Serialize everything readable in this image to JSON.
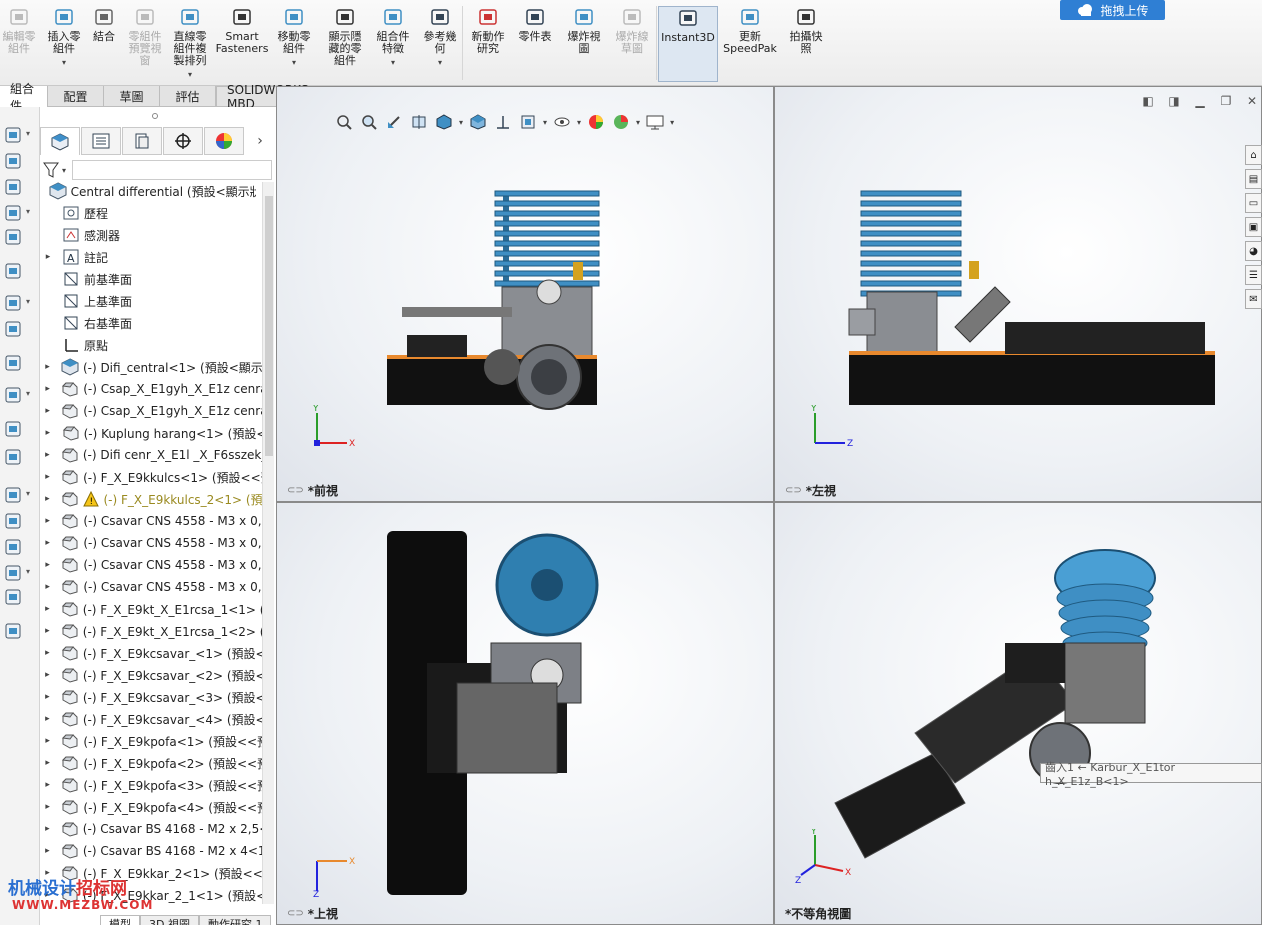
{
  "ribbon": {
    "buttons": [
      {
        "label": "編輯零\n組件",
        "icon": "edit-component-icon",
        "disabled": true
      },
      {
        "label": "插入零\n組件",
        "icon": "insert-component-icon",
        "disabled": false,
        "caret": true
      },
      {
        "label": "結合",
        "icon": "mate-icon",
        "disabled": false
      },
      {
        "label": "零組件\n預覽視\n窗",
        "icon": "component-preview-icon",
        "disabled": true
      },
      {
        "label": "直線零\n組件複\n製排列",
        "icon": "linear-pattern-icon",
        "disabled": false,
        "caret": true
      },
      {
        "label": "Smart\nFasteners",
        "icon": "smart-fasteners-icon",
        "disabled": false
      },
      {
        "label": "移動零\n組件",
        "icon": "move-component-icon",
        "disabled": false,
        "caret": true
      },
      {
        "label": "顯示隱\n藏的零\n組件",
        "icon": "show-hidden-icon",
        "disabled": false
      },
      {
        "label": "組合件\n特徵",
        "icon": "assembly-features-icon",
        "disabled": false,
        "caret": true
      },
      {
        "label": "參考幾\n何",
        "icon": "reference-geometry-icon",
        "disabled": false,
        "caret": true
      },
      {
        "label": "新動作\n研究",
        "icon": "motion-study-icon",
        "disabled": false
      },
      {
        "label": "零件表",
        "icon": "bom-icon",
        "disabled": false
      },
      {
        "label": "爆炸視\n圖",
        "icon": "exploded-view-icon",
        "disabled": false
      },
      {
        "label": "爆炸線\n草圖",
        "icon": "explode-line-sketch-icon",
        "disabled": true
      },
      {
        "label": "Instant3D",
        "icon": "instant3d-icon",
        "disabled": false,
        "active": true
      },
      {
        "label": "更新\nSpeedPak",
        "icon": "speedpak-icon",
        "disabled": false
      },
      {
        "label": "拍攝快\n照",
        "icon": "snapshot-icon",
        "disabled": false
      }
    ],
    "upload_label": "拖拽上传"
  },
  "command_tabs": [
    "組合件",
    "配置",
    "草圖",
    "評估"
  ],
  "mbd_tab": "SOLIDWORKS MBD",
  "tree": {
    "root": "Central differential  (預設<顯示狀態",
    "items": [
      {
        "label": "歷程",
        "icon": "history-icon",
        "expand": false
      },
      {
        "label": "感測器",
        "icon": "sensor-icon",
        "expand": false
      },
      {
        "label": "註記",
        "icon": "annotation-icon",
        "expand": true
      },
      {
        "label": "前基準面",
        "icon": "plane-icon",
        "expand": false
      },
      {
        "label": "上基準面",
        "icon": "plane-icon",
        "expand": false
      },
      {
        "label": "右基準面",
        "icon": "plane-icon",
        "expand": false
      },
      {
        "label": "原點",
        "icon": "origin-icon",
        "expand": false
      },
      {
        "label": "(-) Difi_central<1> (預設<顯示狀",
        "icon": "subassembly-icon",
        "expand": true
      },
      {
        "label": "(-) Csap_X_E1gyh_X_E1z cenral",
        "icon": "part-icon",
        "expand": true
      },
      {
        "label": "(-) Csap_X_E1gyh_X_E1z cenral",
        "icon": "part-icon",
        "expand": true
      },
      {
        "label": "(-) Kuplung harang<1> (預設<",
        "icon": "part-icon",
        "expand": true
      },
      {
        "label": "(-) Difi cenr_X_E1l _X_F6sszek_X",
        "icon": "part-icon",
        "expand": true
      },
      {
        "label": "(-) F_X_E9kkulcs<1> (預設<<預",
        "icon": "part-icon",
        "expand": true
      },
      {
        "label": "(-) F_X_E9kkulcs_2<1> (預設",
        "icon": "part-icon",
        "expand": true,
        "warn": true
      },
      {
        "label": "(-) Csavar CNS 4558 - M3 x 0,5",
        "icon": "part-icon",
        "expand": true
      },
      {
        "label": "(-) Csavar CNS 4558 - M3 x 0,5",
        "icon": "part-icon",
        "expand": true
      },
      {
        "label": "(-) Csavar CNS 4558 - M3 x 0,5",
        "icon": "part-icon",
        "expand": true
      },
      {
        "label": "(-) Csavar CNS 4558 - M3 x 0,5",
        "icon": "part-icon",
        "expand": true
      },
      {
        "label": "(-) F_X_E9kt_X_E1rcsa_1<1> (預",
        "icon": "part-icon",
        "expand": true
      },
      {
        "label": "(-) F_X_E9kt_X_E1rcsa_1<2> (預",
        "icon": "part-icon",
        "expand": true
      },
      {
        "label": "(-) F_X_E9kcsavar_<1> (預設<<",
        "icon": "part-icon",
        "expand": true
      },
      {
        "label": "(-) F_X_E9kcsavar_<2> (預設<<",
        "icon": "part-icon",
        "expand": true
      },
      {
        "label": "(-) F_X_E9kcsavar_<3> (預設<<",
        "icon": "part-icon",
        "expand": true
      },
      {
        "label": "(-) F_X_E9kcsavar_<4> (預設<<",
        "icon": "part-icon",
        "expand": true
      },
      {
        "label": "(-) F_X_E9kpofa<1> (預設<<預",
        "icon": "part-icon",
        "expand": true
      },
      {
        "label": "(-) F_X_E9kpofa<2> (預設<<預",
        "icon": "part-icon",
        "expand": true
      },
      {
        "label": "(-) F_X_E9kpofa<3> (預設<<預",
        "icon": "part-icon",
        "expand": true
      },
      {
        "label": "(-) F_X_E9kpofa<4> (預設<<預",
        "icon": "part-icon",
        "expand": true
      },
      {
        "label": "(-) Csavar BS 4168 - M2 x 2,5<1",
        "icon": "part-icon",
        "expand": true
      },
      {
        "label": "(-) Csavar BS 4168 - M2 x 4<1>",
        "icon": "part-icon",
        "expand": true
      },
      {
        "label": "(-) F_X_E9kkar_2<1> (預設<<預",
        "icon": "part-icon",
        "expand": true
      },
      {
        "label": "(-) F_X_E9kkar_2_1<1> (預設<<",
        "icon": "part-icon",
        "expand": true
      }
    ]
  },
  "bottom_tabs": [
    "模型",
    "3D 視圖",
    "動作研究 1"
  ],
  "viewports": {
    "front": {
      "title": "*前視",
      "axes": [
        "Y",
        "X"
      ]
    },
    "left": {
      "title": "*左視",
      "axes": [
        "Y",
        "Z"
      ]
    },
    "top": {
      "title": "*上視",
      "axes": [
        "Z",
        "X"
      ]
    },
    "iso": {
      "title": "*不等角視圖",
      "axes": [
        "Y",
        "X",
        "Z"
      ]
    }
  },
  "tooltip": "齒入1 ← Karbur_X_E1tor h_X_E1z_B<1>",
  "watermark": {
    "line1a": "机械设计",
    "line1b": "招标网",
    "line2": "WWW.MEZBW.COM"
  },
  "colors": {
    "blue_head": "#2f7fb0",
    "ribbon_active": "#dde7f2",
    "upload": "#2f7fd4"
  }
}
